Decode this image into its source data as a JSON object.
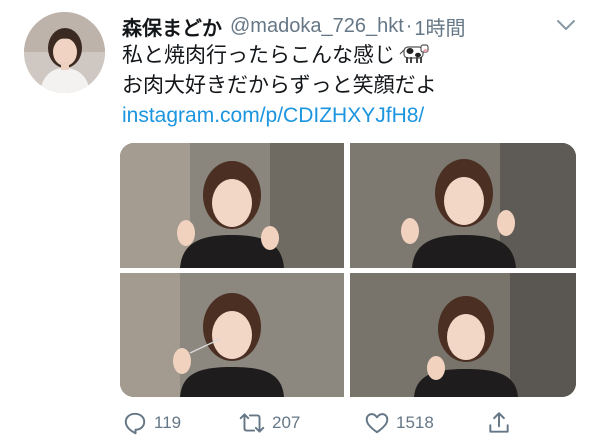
{
  "tweet": {
    "display_name": "森保まどか",
    "handle": "@madoka_726_hkt",
    "separator": "·",
    "time": "1時間",
    "text_line1": "私と焼肉行ったらこんな感じ",
    "text_line2": "お肉大好きだからずっと笑顔だよ",
    "link": "instagram.com/p/CDIZHXYJfH8/",
    "emoji": "cow-icon"
  },
  "actions": {
    "reply_count": "119",
    "retweet_count": "207",
    "like_count": "1518"
  },
  "media": {
    "photo_count": 4
  },
  "colors": {
    "link": "#1b95e0",
    "secondary_text": "#657786",
    "primary_text": "#14171a"
  }
}
